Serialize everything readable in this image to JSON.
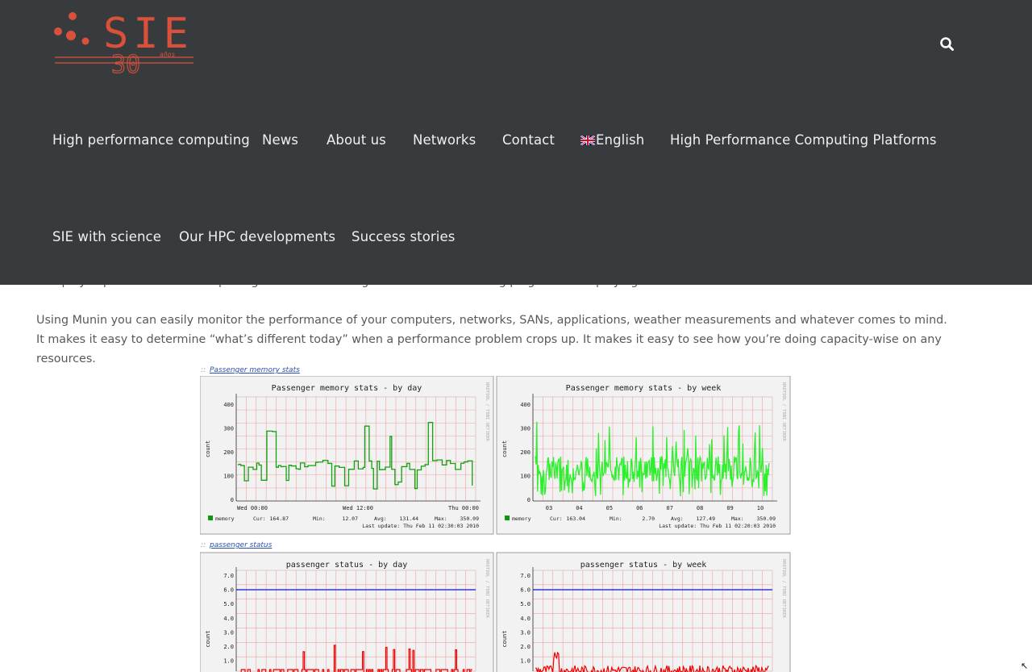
{
  "logo": {
    "brand": "SIE",
    "anniversary": "30",
    "script_text": "años"
  },
  "header": {
    "search_icon": "search-icon",
    "nav_row1": [
      {
        "label": "High performance computing"
      },
      {
        "label": "News"
      },
      {
        "label": "About us"
      },
      {
        "label": "Networks"
      },
      {
        "label": "Contact"
      },
      {
        "label": "English",
        "icon": "uk-flag-icon"
      },
      {
        "label": "High Performance Computing Platforms"
      }
    ],
    "nav_row2": [
      {
        "label": "SIE with science"
      },
      {
        "label": "Our HPC developments"
      },
      {
        "label": "Success stories"
      }
    ]
  },
  "content": {
    "cut_paragraph": "and play capabilities. After completing a installation a high number of monitoring plugins will be playing with no more effort.",
    "paragraph": "Using Munin you can easily monitor the performance of your computers, networks, SANs, applications, weather measurements and whatever comes to mind. It makes it easy to determine “what’s different today” when a performance problem crops up. It makes it easy to see how you’re doing capacity-wise on any resources."
  },
  "graphs": {
    "memory_link": "Passenger memory stats",
    "status_link": "passenger status",
    "colons": "::",
    "side_text": "RRDTOOL / TOBI OETIKER",
    "y_label": "count",
    "memory_day": {
      "title": "Passenger memory stats - by day",
      "x_ticks": [
        "Wed 00:00",
        "Wed 12:00",
        "Thu 00:00"
      ],
      "legend": "memory",
      "cur": "Cur:",
      "cur_v": "164.87",
      "min": "Min:",
      "min_v": "12.07",
      "avg": "Avg:",
      "avg_v": "131.44",
      "max": "Max:",
      "max_v": "350.09",
      "last_update": "Last update:  Thu Feb 11 02:30:03 2010"
    },
    "memory_week": {
      "title": "Passenger memory stats - by week",
      "x_ticks": [
        "03",
        "04",
        "05",
        "06",
        "07",
        "08",
        "09",
        "10"
      ],
      "legend": "memory",
      "cur": "Cur:",
      "cur_v": "163.04",
      "min": "Min:",
      "min_v": "2.70",
      "avg": "Avg:",
      "avg_v": "127.49",
      "max": "Max:",
      "max_v": "350.09",
      "last_update": "Last update:  Thu Feb 11 02:20:03 2010"
    },
    "status_day": {
      "title": "passenger status - by day"
    },
    "status_week": {
      "title": "passenger status - by week"
    },
    "memory_y_ticks": [
      "400",
      "300",
      "200",
      "100",
      "0"
    ],
    "status_y_ticks": [
      "7.0",
      "6.0",
      "5.0",
      "4.0",
      "3.0",
      "2.0",
      "1.0"
    ]
  },
  "colors": {
    "header_bg": "#373b3e",
    "brand": "#d9513b",
    "nav_text": "#eef0f1",
    "body_text": "#595959",
    "grid": "#f0a0a0",
    "memory_day_line": "#0fa30f",
    "memory_week_line": "#2cf02c",
    "status_max_line": "#3333dd",
    "status_line": "#ee0000"
  }
}
